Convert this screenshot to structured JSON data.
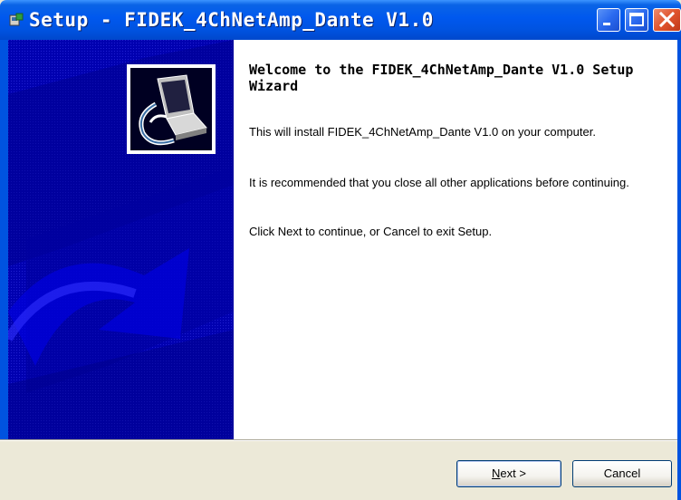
{
  "window": {
    "title": "Setup - FIDEK_4ChNetAmp_Dante V1.0"
  },
  "content": {
    "heading": "Welcome to the FIDEK_4ChNetAmp_Dante V1.0 Setup Wizard",
    "para1": "This will install FIDEK_4ChNetAmp_Dante V1.0 on your computer.",
    "para2": "It is recommended that you close all other applications before continuing.",
    "para3": "Click Next to continue, or Cancel to exit Setup."
  },
  "buttons": {
    "next_underlined": "N",
    "next_rest": "ext >",
    "cancel": "Cancel"
  },
  "colors": {
    "titlebar": "#0058ee",
    "side_panel": "#0000b8",
    "window_face": "#ece9d8"
  },
  "icons": {
    "title": "setup-icon",
    "panel": "computer-install-icon"
  }
}
